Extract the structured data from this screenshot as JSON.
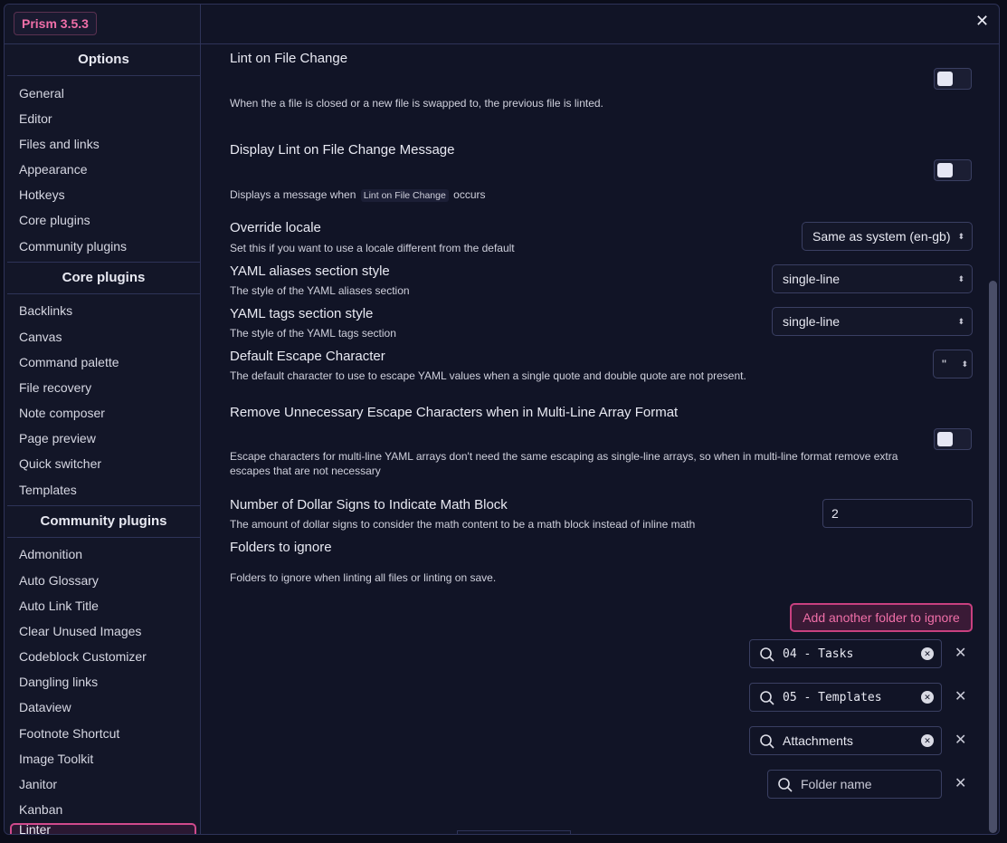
{
  "app": {
    "version_badge": "Prism 3.5.3",
    "close_symbol": "✕"
  },
  "sidebar": {
    "options_header": "Options",
    "options": [
      "General",
      "Editor",
      "Files and links",
      "Appearance",
      "Hotkeys",
      "Core plugins",
      "Community plugins"
    ],
    "core_header": "Core plugins",
    "core": [
      "Backlinks",
      "Canvas",
      "Command palette",
      "File recovery",
      "Note composer",
      "Page preview",
      "Quick switcher",
      "Templates"
    ],
    "community_header": "Community plugins",
    "community": [
      "Admonition",
      "Auto Glossary",
      "Auto Link Title",
      "Clear Unused Images",
      "Codeblock Customizer",
      "Dangling links",
      "Dataview",
      "Footnote Shortcut",
      "Image Toolkit",
      "Janitor",
      "Kanban"
    ],
    "active_item": "Linter"
  },
  "settings": {
    "lint_on_file_change": {
      "title": "Lint on File Change",
      "desc": "When the a file is closed or a new file is swapped to, the previous file is linted.",
      "enabled": false
    },
    "display_lint_message": {
      "title": "Display Lint on File Change Message",
      "desc_before": "Displays a message when",
      "desc_code": "Lint on File Change",
      "desc_after": "occurs",
      "enabled": false
    },
    "override_locale": {
      "title": "Override locale",
      "desc": "Set this if you want to use a locale different from the default",
      "value": "Same as system (en-gb)"
    },
    "yaml_aliases_style": {
      "title": "YAML aliases section style",
      "desc": "The style of the YAML aliases section",
      "value": "single-line"
    },
    "yaml_tags_style": {
      "title": "YAML tags section style",
      "desc": "The style of the YAML tags section",
      "value": "single-line"
    },
    "default_escape_char": {
      "title": "Default Escape Character",
      "desc": "The default character to use to escape YAML values when a single quote and double quote are not present.",
      "value": "\""
    },
    "remove_escape_chars": {
      "title": "Remove Unnecessary Escape Characters when in Multi-Line Array Format",
      "desc": "Escape characters for multi-line YAML arrays don't need the same escaping as single-line arrays, so when in multi-line format remove extra escapes that are not necessary",
      "enabled": false
    },
    "dollar_signs": {
      "title": "Number of Dollar Signs to Indicate Math Block",
      "desc": "The amount of dollar signs to consider the math content to be a math block instead of inline math",
      "value": "2"
    },
    "folders_to_ignore": {
      "title": "Folders to ignore",
      "desc": "Folders to ignore when linting all files or linting on save.",
      "add_button": "Add another folder to ignore",
      "folders": [
        "04 - Tasks",
        "05 - Templates",
        "Attachments"
      ],
      "placeholder": "Folder name"
    }
  },
  "icons": {
    "search": "search-icon",
    "clear": "clear-icon",
    "remove": "close-icon",
    "chevron": "chevron-updown-icon"
  },
  "colors": {
    "accent": "#d04a8c",
    "background": "#111426",
    "border": "#2e3358"
  }
}
